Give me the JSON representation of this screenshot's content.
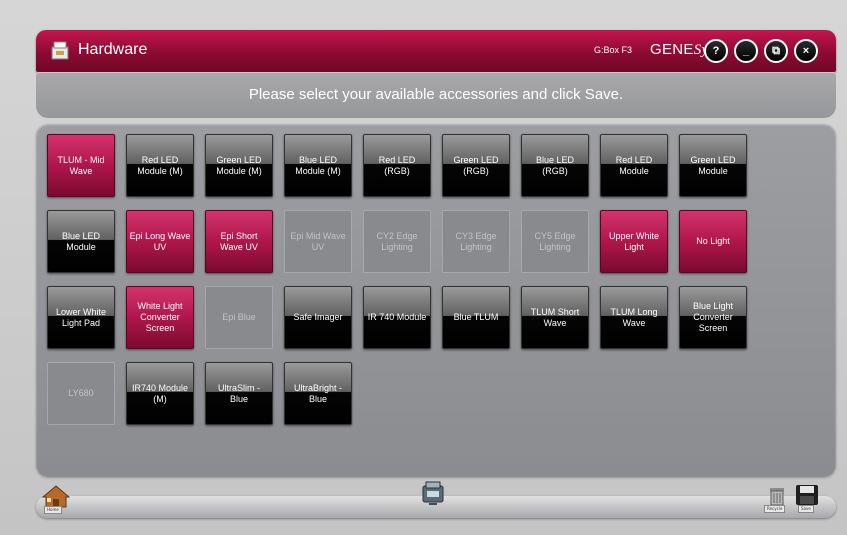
{
  "titlebar": {
    "title": "Hardware",
    "device": "G:Box F3",
    "brand_main": "GENE",
    "brand_italic": "Sys",
    "help_label": "?",
    "minimize_label": "_",
    "restore_label": "⧉",
    "close_label": "×"
  },
  "instruction": "Please select your available accessories and click Save.",
  "tiles": [
    {
      "label": "TLUM - Mid Wave",
      "state": "selected"
    },
    {
      "label": "Red LED Module (M)",
      "state": "available"
    },
    {
      "label": "Green LED Module (M)",
      "state": "available"
    },
    {
      "label": "Blue LED Module (M)",
      "state": "available"
    },
    {
      "label": "Red LED (RGB)",
      "state": "available"
    },
    {
      "label": "Green LED (RGB)",
      "state": "available"
    },
    {
      "label": "Blue LED (RGB)",
      "state": "available"
    },
    {
      "label": "Red LED Module",
      "state": "available"
    },
    {
      "label": "Green LED Module",
      "state": "available"
    },
    {
      "label": "Blue LED Module",
      "state": "available"
    },
    {
      "label": "Epi Long Wave UV",
      "state": "selected"
    },
    {
      "label": "Epi Short Wave UV",
      "state": "selected"
    },
    {
      "label": "Epi Mid Wave UV",
      "state": "disabled"
    },
    {
      "label": "CY2 Edge Lighting",
      "state": "disabled"
    },
    {
      "label": "CY3 Edge Lighting",
      "state": "disabled"
    },
    {
      "label": "CY5 Edge Lighting",
      "state": "disabled"
    },
    {
      "label": "Upper White Light",
      "state": "selected"
    },
    {
      "label": "No Light",
      "state": "selected"
    },
    {
      "label": "Lower White Light Pad",
      "state": "available"
    },
    {
      "label": "White Light Converter Screen",
      "state": "selected"
    },
    {
      "label": "Epi Blue",
      "state": "disabled"
    },
    {
      "label": "Safe Imager",
      "state": "available"
    },
    {
      "label": "IR 740 Module",
      "state": "available"
    },
    {
      "label": "Blue TLUM",
      "state": "available"
    },
    {
      "label": "TLUM Short Wave",
      "state": "available"
    },
    {
      "label": "TLUM Long Wave",
      "state": "available"
    },
    {
      "label": "Blue Light Converter Screen",
      "state": "available"
    },
    {
      "label": "LY680",
      "state": "disabled"
    },
    {
      "label": "IR740 Module (M)",
      "state": "available"
    },
    {
      "label": "UltraSlim - Blue",
      "state": "available"
    },
    {
      "label": "UltraBright - Blue",
      "state": "available"
    }
  ],
  "bottombar": {
    "home_label": "Home",
    "recycle_label": "Recycle",
    "save_label": "Save"
  },
  "icons": {
    "title": "hardware-box-icon",
    "home": "home-icon",
    "center": "gelbox-device-icon",
    "recycle": "recycle-bin-icon",
    "save": "save-disk-icon"
  },
  "colors": {
    "titlebar": "#8c0a33",
    "selected_tile": "#b0164b",
    "available_tile": "#000000",
    "disabled_tile": "#898a8d",
    "panel": "#9d9ea1"
  }
}
